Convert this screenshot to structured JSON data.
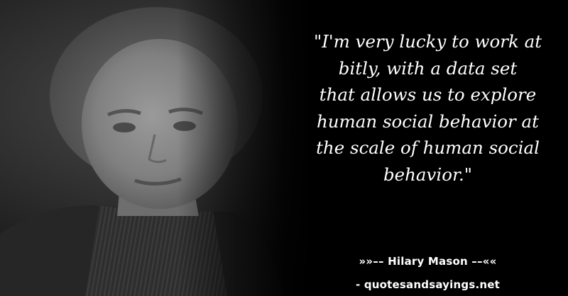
{
  "quote": {
    "text": "\"I'm very lucky to work at\nbitly, with a data set\nthat allows us to explore\nhuman social behavior at\nthe scale of human social\nbehavior.\""
  },
  "attribution": {
    "author": "»»–– Hilary Mason ––««",
    "source": "- quotesandsayings.net"
  },
  "colors": {
    "background": "#000000",
    "text": "#ffffff"
  }
}
